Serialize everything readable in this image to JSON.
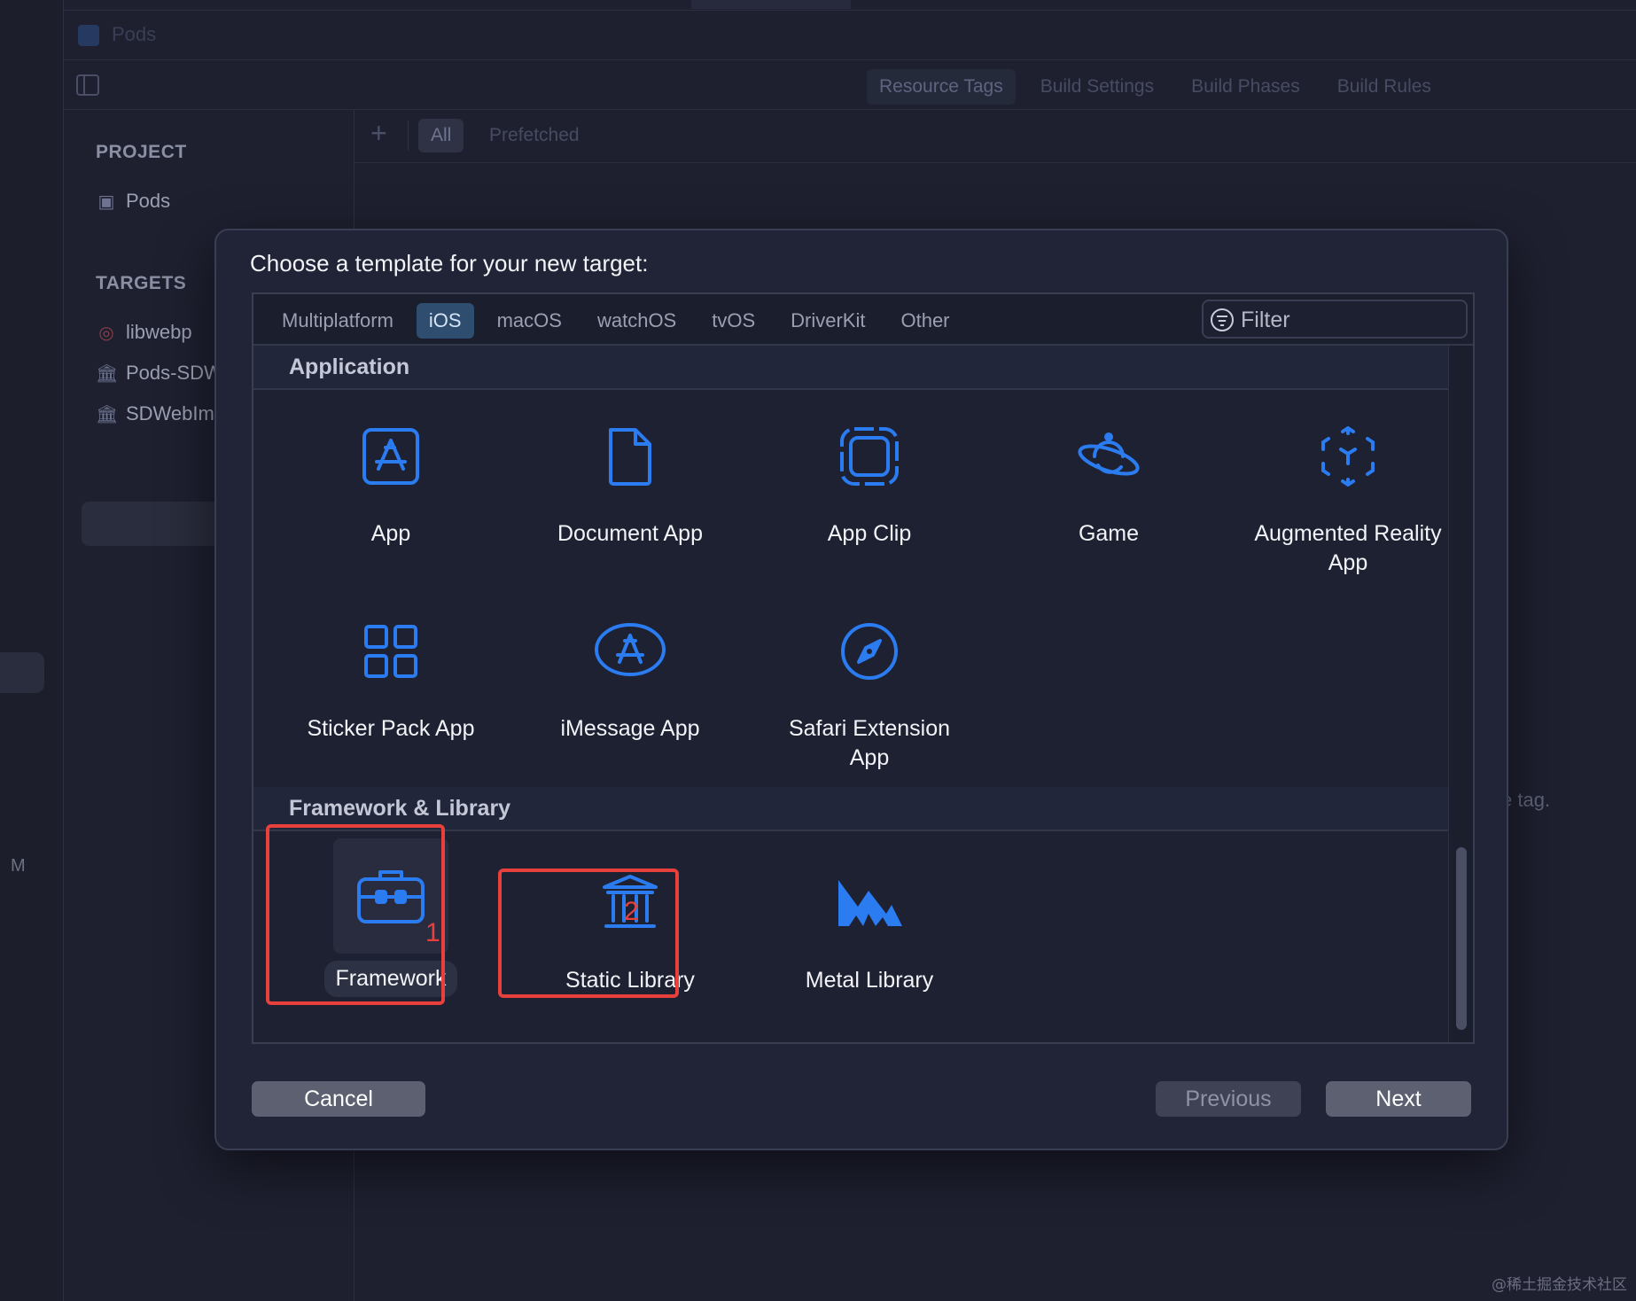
{
  "window": {
    "project_name": "Pods"
  },
  "editor_tabs": [
    "Resource Tags",
    "Build Settings",
    "Build Phases",
    "Build Rules"
  ],
  "tag_filters": {
    "all": "All",
    "prefetched": "Prefetched"
  },
  "navigator": {
    "project_header": "PROJECT",
    "project_item": "Pods",
    "targets_header": "TARGETS",
    "targets": [
      "libwebp",
      "Pods-SDW",
      "SDWebIm"
    ]
  },
  "rail_letter": "M",
  "background_hint": "e tag.",
  "sheet": {
    "title": "Choose a template for your new target:",
    "platforms": [
      "Multiplatform",
      "iOS",
      "macOS",
      "watchOS",
      "tvOS",
      "DriverKit",
      "Other"
    ],
    "selected_platform": "iOS",
    "filter_placeholder": "Filter",
    "sections": [
      {
        "title": "Application",
        "templates": [
          {
            "label": "App",
            "icon": "app-store-icon"
          },
          {
            "label": "Document App",
            "icon": "document-icon"
          },
          {
            "label": "App Clip",
            "icon": "app-clip-icon"
          },
          {
            "label": "Game",
            "icon": "planet-icon"
          },
          {
            "label": "Augmented Reality App",
            "icon": "ar-cube-icon"
          },
          {
            "label": "Sticker Pack App",
            "icon": "grid-icon"
          },
          {
            "label": "iMessage App",
            "icon": "imessage-icon"
          },
          {
            "label": "Safari Extension App",
            "icon": "compass-icon"
          }
        ]
      },
      {
        "title": "Framework & Library",
        "templates": [
          {
            "label": "Framework",
            "icon": "toolbox-icon",
            "selected": true
          },
          {
            "label": "Static Library",
            "icon": "columns-icon"
          },
          {
            "label": "Metal Library",
            "icon": "metal-icon"
          }
        ]
      }
    ],
    "annotations": [
      "1",
      "2"
    ],
    "buttons": {
      "cancel": "Cancel",
      "previous": "Previous",
      "next": "Next"
    }
  },
  "watermark": "@稀土掘金技术社区",
  "colors": {
    "accent_blue": "#2b7cf0",
    "annotation_red": "#e8403d",
    "sheet_bg": "#202436"
  }
}
